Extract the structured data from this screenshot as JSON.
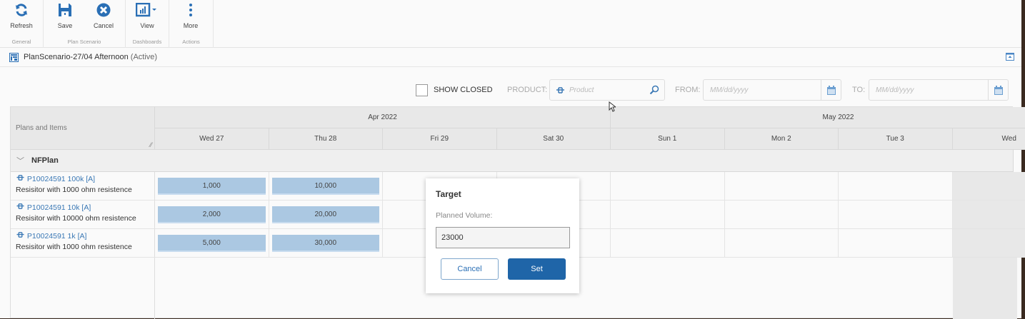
{
  "ribbon": {
    "groups": [
      {
        "label": "General",
        "buttons": [
          {
            "label": "Refresh",
            "icon": "refresh-icon"
          }
        ]
      },
      {
        "label": "Plan Scenario",
        "buttons": [
          {
            "label": "Save",
            "icon": "save-icon"
          },
          {
            "label": "Cancel",
            "icon": "cancel-icon"
          }
        ]
      },
      {
        "label": "Dashboards",
        "buttons": [
          {
            "label": "View",
            "icon": "chart-icon"
          }
        ]
      },
      {
        "label": "Actions",
        "buttons": [
          {
            "label": "More",
            "icon": "more-icon"
          }
        ]
      }
    ]
  },
  "title": {
    "name": "PlanScenario-27/04 Afternoon",
    "status": "(Active)"
  },
  "filters": {
    "show_closed": "SHOW CLOSED",
    "product_label": "PRODUCT:",
    "product_placeholder": "Product",
    "from_label": "FROM:",
    "from_placeholder": "MM/dd/yyyy",
    "to_label": "TO:",
    "to_placeholder": "MM/dd/yyyy"
  },
  "grid": {
    "header": "Plans and Items",
    "months": [
      {
        "label": "Apr 2022",
        "span": 4
      },
      {
        "label": "May 2022",
        "span": 4
      }
    ],
    "days": [
      "Wed 27",
      "Thu 28",
      "Fri 29",
      "Sat 30",
      "Sun 1",
      "Mon 2",
      "Tue 3",
      "Wed"
    ],
    "plan": "NFPlan",
    "rows": [
      {
        "code": "P10024591 100k [A]",
        "desc": "Resisitor with 1000 ohm resistence",
        "values": [
          "1,000",
          "10,000"
        ]
      },
      {
        "code": "P10024591 10k [A]",
        "desc": "Resisitor with 10000 ohm resistence",
        "values": [
          "2,000",
          "20,000"
        ]
      },
      {
        "code": "P10024591 1k [A]",
        "desc": "Resisitor with 1000 ohm resistence",
        "values": [
          "5,000",
          "30,000"
        ]
      }
    ]
  },
  "dialog": {
    "title": "Target",
    "label": "Planned Volume:",
    "value": "23000",
    "cancel": "Cancel",
    "set": "Set"
  },
  "colors": {
    "accent": "#1f65a8",
    "cell": "#abc8e2",
    "link": "#3a78b5"
  }
}
